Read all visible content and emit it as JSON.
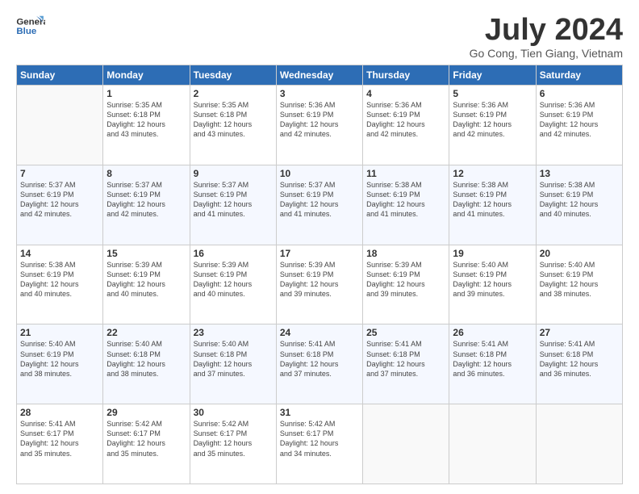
{
  "header": {
    "logo_line1": "General",
    "logo_line2": "Blue",
    "month_title": "July 2024",
    "subtitle": "Go Cong, Tien Giang, Vietnam"
  },
  "days_of_week": [
    "Sunday",
    "Monday",
    "Tuesday",
    "Wednesday",
    "Thursday",
    "Friday",
    "Saturday"
  ],
  "weeks": [
    [
      {
        "day": "",
        "info": ""
      },
      {
        "day": "1",
        "info": "Sunrise: 5:35 AM\nSunset: 6:18 PM\nDaylight: 12 hours\nand 43 minutes."
      },
      {
        "day": "2",
        "info": "Sunrise: 5:35 AM\nSunset: 6:18 PM\nDaylight: 12 hours\nand 43 minutes."
      },
      {
        "day": "3",
        "info": "Sunrise: 5:36 AM\nSunset: 6:19 PM\nDaylight: 12 hours\nand 42 minutes."
      },
      {
        "day": "4",
        "info": "Sunrise: 5:36 AM\nSunset: 6:19 PM\nDaylight: 12 hours\nand 42 minutes."
      },
      {
        "day": "5",
        "info": "Sunrise: 5:36 AM\nSunset: 6:19 PM\nDaylight: 12 hours\nand 42 minutes."
      },
      {
        "day": "6",
        "info": "Sunrise: 5:36 AM\nSunset: 6:19 PM\nDaylight: 12 hours\nand 42 minutes."
      }
    ],
    [
      {
        "day": "7",
        "info": "Sunrise: 5:37 AM\nSunset: 6:19 PM\nDaylight: 12 hours\nand 42 minutes."
      },
      {
        "day": "8",
        "info": "Sunrise: 5:37 AM\nSunset: 6:19 PM\nDaylight: 12 hours\nand 42 minutes."
      },
      {
        "day": "9",
        "info": "Sunrise: 5:37 AM\nSunset: 6:19 PM\nDaylight: 12 hours\nand 41 minutes."
      },
      {
        "day": "10",
        "info": "Sunrise: 5:37 AM\nSunset: 6:19 PM\nDaylight: 12 hours\nand 41 minutes."
      },
      {
        "day": "11",
        "info": "Sunrise: 5:38 AM\nSunset: 6:19 PM\nDaylight: 12 hours\nand 41 minutes."
      },
      {
        "day": "12",
        "info": "Sunrise: 5:38 AM\nSunset: 6:19 PM\nDaylight: 12 hours\nand 41 minutes."
      },
      {
        "day": "13",
        "info": "Sunrise: 5:38 AM\nSunset: 6:19 PM\nDaylight: 12 hours\nand 40 minutes."
      }
    ],
    [
      {
        "day": "14",
        "info": "Sunrise: 5:38 AM\nSunset: 6:19 PM\nDaylight: 12 hours\nand 40 minutes."
      },
      {
        "day": "15",
        "info": "Sunrise: 5:39 AM\nSunset: 6:19 PM\nDaylight: 12 hours\nand 40 minutes."
      },
      {
        "day": "16",
        "info": "Sunrise: 5:39 AM\nSunset: 6:19 PM\nDaylight: 12 hours\nand 40 minutes."
      },
      {
        "day": "17",
        "info": "Sunrise: 5:39 AM\nSunset: 6:19 PM\nDaylight: 12 hours\nand 39 minutes."
      },
      {
        "day": "18",
        "info": "Sunrise: 5:39 AM\nSunset: 6:19 PM\nDaylight: 12 hours\nand 39 minutes."
      },
      {
        "day": "19",
        "info": "Sunrise: 5:40 AM\nSunset: 6:19 PM\nDaylight: 12 hours\nand 39 minutes."
      },
      {
        "day": "20",
        "info": "Sunrise: 5:40 AM\nSunset: 6:19 PM\nDaylight: 12 hours\nand 38 minutes."
      }
    ],
    [
      {
        "day": "21",
        "info": "Sunrise: 5:40 AM\nSunset: 6:19 PM\nDaylight: 12 hours\nand 38 minutes."
      },
      {
        "day": "22",
        "info": "Sunrise: 5:40 AM\nSunset: 6:18 PM\nDaylight: 12 hours\nand 38 minutes."
      },
      {
        "day": "23",
        "info": "Sunrise: 5:40 AM\nSunset: 6:18 PM\nDaylight: 12 hours\nand 37 minutes."
      },
      {
        "day": "24",
        "info": "Sunrise: 5:41 AM\nSunset: 6:18 PM\nDaylight: 12 hours\nand 37 minutes."
      },
      {
        "day": "25",
        "info": "Sunrise: 5:41 AM\nSunset: 6:18 PM\nDaylight: 12 hours\nand 37 minutes."
      },
      {
        "day": "26",
        "info": "Sunrise: 5:41 AM\nSunset: 6:18 PM\nDaylight: 12 hours\nand 36 minutes."
      },
      {
        "day": "27",
        "info": "Sunrise: 5:41 AM\nSunset: 6:18 PM\nDaylight: 12 hours\nand 36 minutes."
      }
    ],
    [
      {
        "day": "28",
        "info": "Sunrise: 5:41 AM\nSunset: 6:17 PM\nDaylight: 12 hours\nand 35 minutes."
      },
      {
        "day": "29",
        "info": "Sunrise: 5:42 AM\nSunset: 6:17 PM\nDaylight: 12 hours\nand 35 minutes."
      },
      {
        "day": "30",
        "info": "Sunrise: 5:42 AM\nSunset: 6:17 PM\nDaylight: 12 hours\nand 35 minutes."
      },
      {
        "day": "31",
        "info": "Sunrise: 5:42 AM\nSunset: 6:17 PM\nDaylight: 12 hours\nand 34 minutes."
      },
      {
        "day": "",
        "info": ""
      },
      {
        "day": "",
        "info": ""
      },
      {
        "day": "",
        "info": ""
      }
    ]
  ]
}
